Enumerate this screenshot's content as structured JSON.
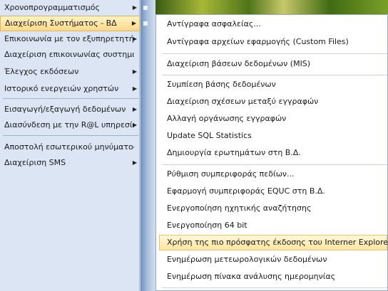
{
  "left_menu": {
    "items": [
      {
        "label": "Χρονοπρογραμματισμός",
        "submenu": true
      },
      {
        "label": "Διαχείριση Συστήματος - ΒΔ",
        "submenu": true
      },
      {
        "label": "Επικοινωνία με τον εξυπηρετητή",
        "submenu": true
      },
      {
        "label": "Διαχείριση επικοινωνίας συστημάτων",
        "submenu": false
      },
      {
        "label": "Έλεγχος εκδόσεων",
        "submenu": true
      },
      {
        "label": "Ιστορικό ενεργειών χρηστών",
        "submenu": true
      },
      {
        "label": "Εισαγωγή/εξαγωγή δεδομένων",
        "submenu": true
      },
      {
        "label": "Διασύνδεση με την R@L υπηρεσία",
        "submenu": true
      },
      {
        "label": "Αποστολή εσωτερικού μηνύματος ...",
        "submenu": false
      },
      {
        "label": "Διαχείριση SMS",
        "submenu": true
      }
    ],
    "arrow": "▶"
  },
  "submenu": {
    "items": [
      {
        "label": "Αντίγραφα ασφαλείας..."
      },
      {
        "label": "Αντίγραφα αρχείων εφαρμογής (Custom Files)"
      },
      {
        "label": "Διαχείριση βάσεων δεδομένων (MIS)"
      },
      {
        "label": "Συμπίεση βάσης δεδομένων"
      },
      {
        "label": "Διαχείριση σχέσεων μεταξύ εγγραφών"
      },
      {
        "label": "Αλλαγή οργάνωσης εγγραφών"
      },
      {
        "label": "Update SQL Statistics"
      },
      {
        "label": "Δημιουργία ερωτημάτων στη Β.Δ."
      },
      {
        "label": "Ρύθμιση συμπεριφοράς πεδίων..."
      },
      {
        "label": "Εφαρμογή συμπεριφοράς EQUC στη Β.Δ."
      },
      {
        "label": "Ενεργοποίηση ηχητικής αναζήτησης"
      },
      {
        "label": "Ενεργοποίηση 64 bit"
      },
      {
        "label": "Χρήση της πιο πρόσφατης έκδοσης του Interner Explorer"
      },
      {
        "label": "Ενημέρωση μετεωρολογικών δεδομένων"
      },
      {
        "label": "Ενημέρωση πίνακα ανάλυσης ημερομηνίας"
      }
    ]
  },
  "colors": {
    "highlight": "#ffe6a0",
    "menu_bg": "#dbe5f3"
  }
}
